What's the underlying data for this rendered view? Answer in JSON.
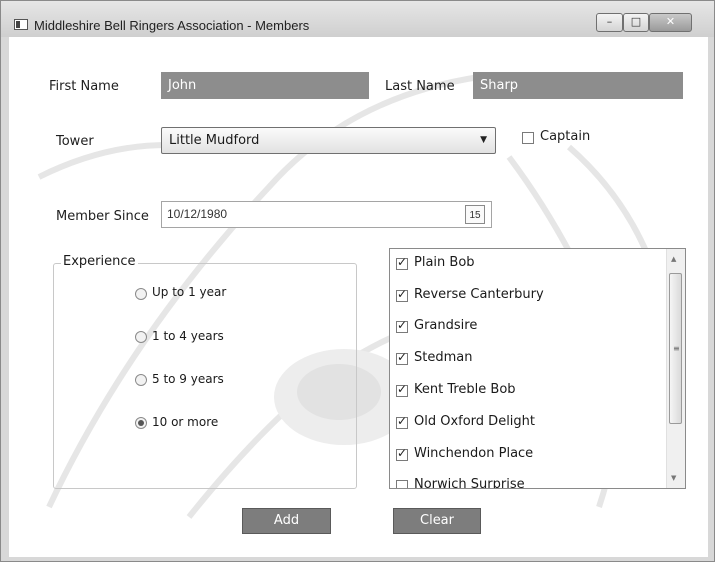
{
  "window": {
    "title": "Middleshire Bell Ringers Association - Members",
    "buttons": {
      "minimize": "–",
      "maximize": "□",
      "close": "✕"
    }
  },
  "form": {
    "first_name_label": "First Name",
    "first_name_value": "John",
    "last_name_label": "Last Name",
    "last_name_value": "Sharp",
    "tower_label": "Tower",
    "tower_value": "Little Mudford",
    "captain_label": "Captain",
    "captain_checked": false,
    "member_since_label": "Member Since",
    "member_since_value": "10/12/1980",
    "calendar_icon_text": "15"
  },
  "experience": {
    "title": "Experience",
    "options": [
      {
        "label": "Up to 1 year",
        "selected": false
      },
      {
        "label": "1 to 4 years",
        "selected": false
      },
      {
        "label": "5 to 9 years",
        "selected": false
      },
      {
        "label": "10 or more",
        "selected": true
      }
    ]
  },
  "methods": {
    "items": [
      {
        "label": "Plain Bob",
        "checked": true
      },
      {
        "label": "Reverse Canterbury",
        "checked": true
      },
      {
        "label": "Grandsire",
        "checked": true
      },
      {
        "label": "Stedman",
        "checked": true
      },
      {
        "label": "Kent Treble Bob",
        "checked": true
      },
      {
        "label": "Old Oxford Delight",
        "checked": true
      },
      {
        "label": "Winchendon Place",
        "checked": true
      },
      {
        "label": "Norwich Surprise",
        "checked": false
      }
    ]
  },
  "actions": {
    "add_label": "Add",
    "clear_label": "Clear"
  },
  "icons": {
    "app": "window-icon",
    "dropdown": "chevron-down-icon",
    "calendar": "calendar-icon",
    "scroll_up": "arrow-up-icon",
    "scroll_down": "arrow-down-icon"
  }
}
